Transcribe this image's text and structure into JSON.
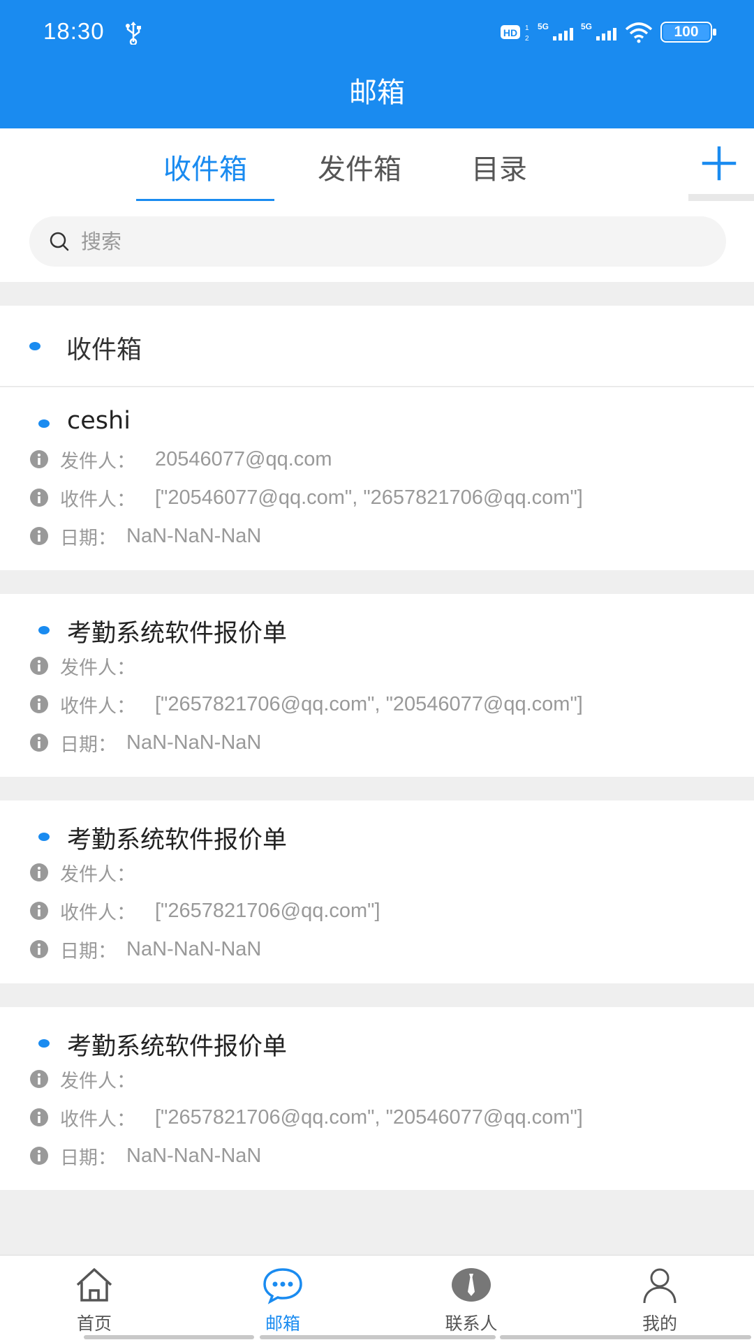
{
  "status_bar": {
    "time": "18:30",
    "battery": "100",
    "hd_label": "HD",
    "network_1": "5G",
    "network_2": "5G"
  },
  "header": {
    "title": "邮箱"
  },
  "tabs": [
    {
      "label": "收件箱",
      "active": true
    },
    {
      "label": "发件箱",
      "active": false
    },
    {
      "label": "目录",
      "active": false
    }
  ],
  "search": {
    "placeholder": "搜索",
    "value": ""
  },
  "section": {
    "title": "收件箱"
  },
  "labels": {
    "sender": "发件人：",
    "recipients": "收件人：",
    "date": "日期："
  },
  "mails": [
    {
      "subject": "ceshi",
      "sender": "20546077@qq.com",
      "recipients": "[\"20546077@qq.com\", \"2657821706@qq.com\"]",
      "date": "NaN-NaN-NaN"
    },
    {
      "subject": "考勤系统软件报价单",
      "sender": "",
      "recipients": "[\"2657821706@qq.com\", \"20546077@qq.com\"]",
      "date": "NaN-NaN-NaN"
    },
    {
      "subject": "考勤系统软件报价单",
      "sender": "",
      "recipients": "[\"2657821706@qq.com\"]",
      "date": "NaN-NaN-NaN"
    },
    {
      "subject": "考勤系统软件报价单",
      "sender": "",
      "recipients": "[\"2657821706@qq.com\", \"20546077@qq.com\"]",
      "date": "NaN-NaN-NaN"
    }
  ],
  "bottom_nav": [
    {
      "label": "首页",
      "icon": "home-icon",
      "active": false
    },
    {
      "label": "邮箱",
      "icon": "chat-bubble-icon",
      "active": true
    },
    {
      "label": "联系人",
      "icon": "tie-icon",
      "active": false
    },
    {
      "label": "我的",
      "icon": "person-icon",
      "active": false
    }
  ],
  "colors": {
    "accent": "#1a8bf0",
    "background": "#efefef",
    "muted_text": "#999999"
  }
}
